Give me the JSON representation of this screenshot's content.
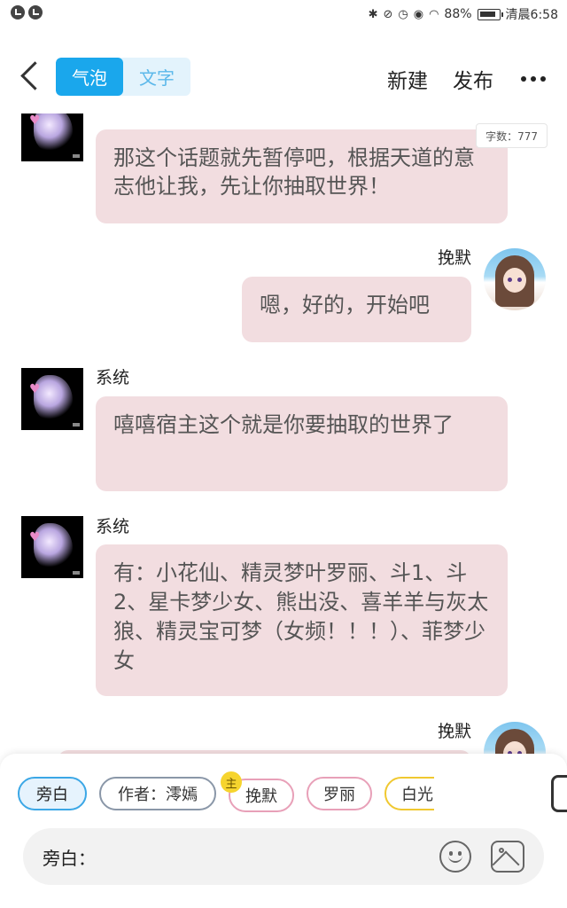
{
  "status_bar": {
    "battery": "88%",
    "time": "清晨6:58"
  },
  "header": {
    "mode_tabs": [
      "气泡",
      "文字"
    ],
    "new_label": "新建",
    "publish_label": "发布"
  },
  "char_count": "字数：777",
  "messages": [
    {
      "sender": "",
      "text": "那这个话题就先暂停吧，根据天道的意志他让我，先让你抽取世界！"
    },
    {
      "sender": "挽默",
      "text": "嗯，好的，开始吧"
    },
    {
      "sender": "系统",
      "text": "嘻嘻宿主这个就是你要抽取的世界了"
    },
    {
      "sender": "系统",
      "text": "有：小花仙、精灵梦叶罗丽、斗1、斗2、星卡梦少女、熊出没、喜羊羊与灰太狼、精灵宝可梦（女频！！！）、菲梦少女"
    },
    {
      "sender": "挽默",
      "text": ""
    }
  ],
  "roles": {
    "narrator": "旁白",
    "author": "作者：澪嫣",
    "main_badge": "主",
    "wanmo": "挽默",
    "luoli": "罗丽",
    "baiguang": "白光"
  },
  "input": {
    "label": "旁白："
  }
}
